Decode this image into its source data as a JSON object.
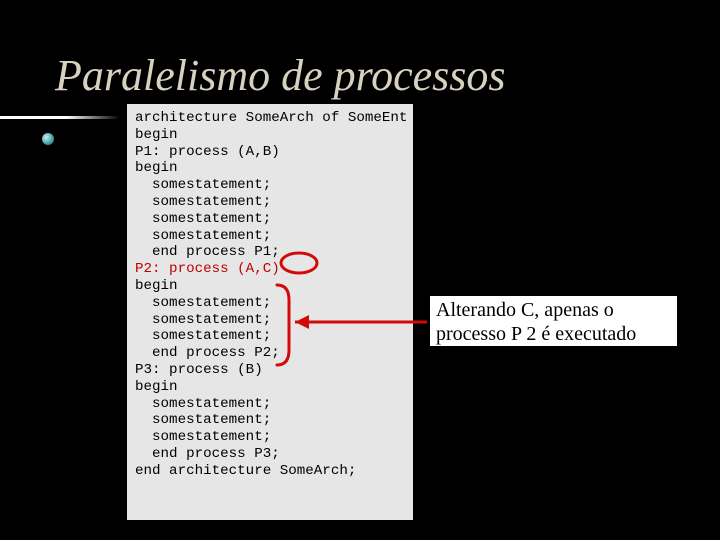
{
  "title": "Paralelismo de processos",
  "code": {
    "pre": "architecture SomeArch of SomeEnt is\nbegin\nP1: process (A,B)\nbegin\n  somestatement;\n  somestatement;\n  somestatement;\n  somestatement;\n  end process P1;\n",
    "p2": "P2: process (A,C)\n",
    "post": "begin\n  somestatement;\n  somestatement;\n  somestatement;\n  end process P2;\nP3: process (B)\nbegin\n  somestatement;\n  somestatement;\n  somestatement;\n  end process P3;\nend architecture SomeArch;"
  },
  "callout": {
    "line1": "Alterando C, apenas o",
    "line2": "processo P 2 é executado"
  }
}
